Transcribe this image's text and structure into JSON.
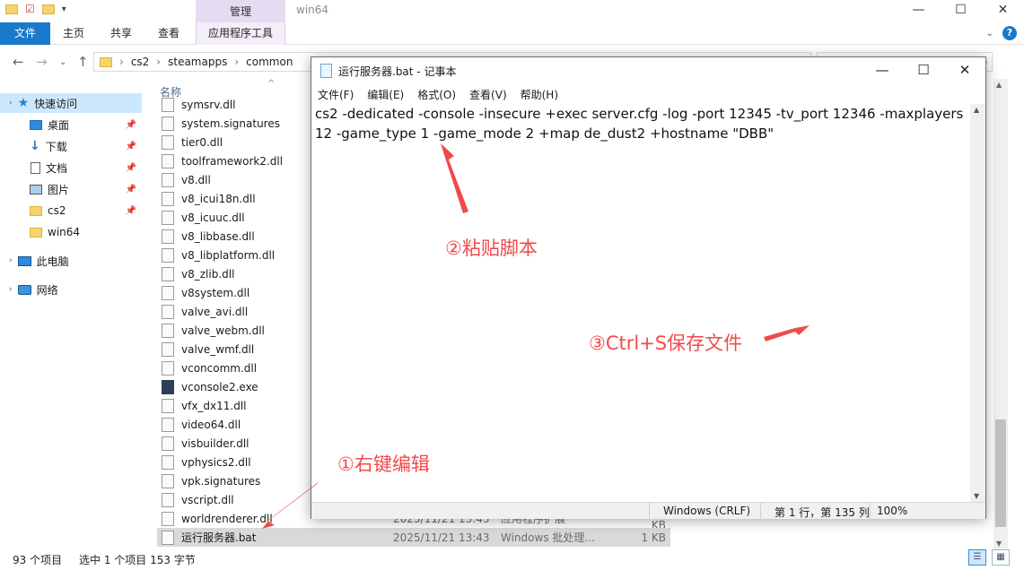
{
  "titlebar": {
    "context_tab": "管理",
    "window_title": "win64"
  },
  "ribbon": {
    "tabs": {
      "file": "文件",
      "home": "主页",
      "share": "共享",
      "view": "查看",
      "app_tools": "应用程序工具"
    }
  },
  "address": {
    "crumbs": [
      "cs2",
      "steamapps",
      "common"
    ]
  },
  "nav": {
    "quick_access": "快速访问",
    "items": [
      {
        "label": "桌面",
        "icon": "desktop-icon",
        "pinned": true
      },
      {
        "label": "下载",
        "icon": "download-icon",
        "pinned": true
      },
      {
        "label": "文档",
        "icon": "document-icon",
        "pinned": true
      },
      {
        "label": "图片",
        "icon": "picture-icon",
        "pinned": true
      },
      {
        "label": "cs2",
        "icon": "folder-icon",
        "pinned": true
      },
      {
        "label": "win64",
        "icon": "folder-icon",
        "pinned": false
      }
    ],
    "this_pc": "此电脑",
    "network": "网络"
  },
  "filelist": {
    "column_name": "名称",
    "files": [
      {
        "name": "symsrv.dll"
      },
      {
        "name": "system.signatures"
      },
      {
        "name": "tier0.dll"
      },
      {
        "name": "toolframework2.dll"
      },
      {
        "name": "v8.dll"
      },
      {
        "name": "v8_icui18n.dll"
      },
      {
        "name": "v8_icuuc.dll"
      },
      {
        "name": "v8_libbase.dll"
      },
      {
        "name": "v8_libplatform.dll"
      },
      {
        "name": "v8_zlib.dll"
      },
      {
        "name": "v8system.dll"
      },
      {
        "name": "valve_avi.dll"
      },
      {
        "name": "valve_webm.dll"
      },
      {
        "name": "valve_wmf.dll"
      },
      {
        "name": "vconcomm.dll"
      },
      {
        "name": "vconsole2.exe"
      },
      {
        "name": "vfx_dx11.dll"
      },
      {
        "name": "video64.dll"
      },
      {
        "name": "visbuilder.dll"
      },
      {
        "name": "vphysics2.dll"
      },
      {
        "name": "vpk.signatures"
      },
      {
        "name": "vscript.dll"
      },
      {
        "name": "worldrenderer.dll",
        "date": "2025/11/21 13:43",
        "type": "应用程序扩展",
        "size": "1,170 KB"
      }
    ],
    "selected": {
      "name": "运行服务器.bat",
      "date": "2025/11/21 13:43",
      "type": "Windows 批处理...",
      "size": "1 KB"
    }
  },
  "statusbar": {
    "count": "93 个项目",
    "selection": "选中 1 个项目  153 字节"
  },
  "notepad": {
    "title": "运行服务器.bat - 记事本",
    "menu": [
      "文件(F)",
      "编辑(E)",
      "格式(O)",
      "查看(V)",
      "帮助(H)"
    ],
    "content": "cs2 -dedicated -console -insecure +exec server.cfg -log -port 12345 -tv_port 12346 -maxplayers 12 -game_type 1 -game_mode 2 +map de_dust2 +hostname \"DBB\"",
    "status": {
      "line_ending": "Windows (CRLF)",
      "position": "第 1 行，第 135 列",
      "zoom": "100%"
    }
  },
  "annotations": {
    "step1": "①右键编辑",
    "step2": "②粘贴脚本",
    "step3": "③Ctrl+S保存文件",
    "color": "#f04a4a"
  }
}
